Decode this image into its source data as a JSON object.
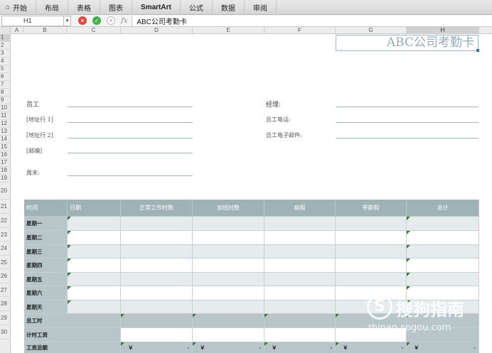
{
  "ribbon": {
    "tabs": [
      {
        "label": "开始",
        "bold": false
      },
      {
        "label": "布局",
        "bold": false
      },
      {
        "label": "表格",
        "bold": false
      },
      {
        "label": "图表",
        "bold": false
      },
      {
        "label": "SmartArt",
        "bold": true
      },
      {
        "label": "公式",
        "bold": false
      },
      {
        "label": "数据",
        "bold": false
      },
      {
        "label": "审阅",
        "bold": false
      }
    ]
  },
  "formula_bar": {
    "name_box": "H1",
    "fx": "fx",
    "content": "ABC公司考勤卡"
  },
  "columns": [
    "A",
    "B",
    "C",
    "D",
    "E",
    "F",
    "G",
    "H"
  ],
  "selected_column": "H",
  "rows": [
    "1",
    "2",
    "3",
    "4",
    "5",
    "6",
    "7",
    "8",
    "9",
    "10",
    "11",
    "12",
    "13",
    "14",
    "15",
    "16",
    "17",
    "18",
    "19",
    "20",
    "21",
    "22",
    "23",
    "24",
    "25",
    "26",
    "27",
    "28",
    "29",
    "30"
  ],
  "sheet": {
    "title": "ABC公司考勤卡",
    "labels": {
      "employee": "员工",
      "address1": "[地址行 1]",
      "address2": "[地址行 2]",
      "postcode": "[邮编]",
      "week_end": "周末:",
      "manager": "经理:",
      "phone": "员工电话:",
      "email": "员工电子邮件:"
    },
    "table": {
      "headers": [
        "时间",
        "日期",
        "正常工作时数",
        "加班时数",
        "病假",
        "带薪假",
        "总计"
      ],
      "days": [
        "星期一",
        "星期二",
        "星期三",
        "星期四",
        "星期五",
        "星期六",
        "星期天"
      ],
      "summary": [
        "总工时",
        "计时工资",
        "工资总额"
      ],
      "currency": "￥",
      "dash": "-"
    }
  },
  "watermark": {
    "logo": "S",
    "text": "搜狗指南",
    "url": "zhinan.sogou.com"
  }
}
